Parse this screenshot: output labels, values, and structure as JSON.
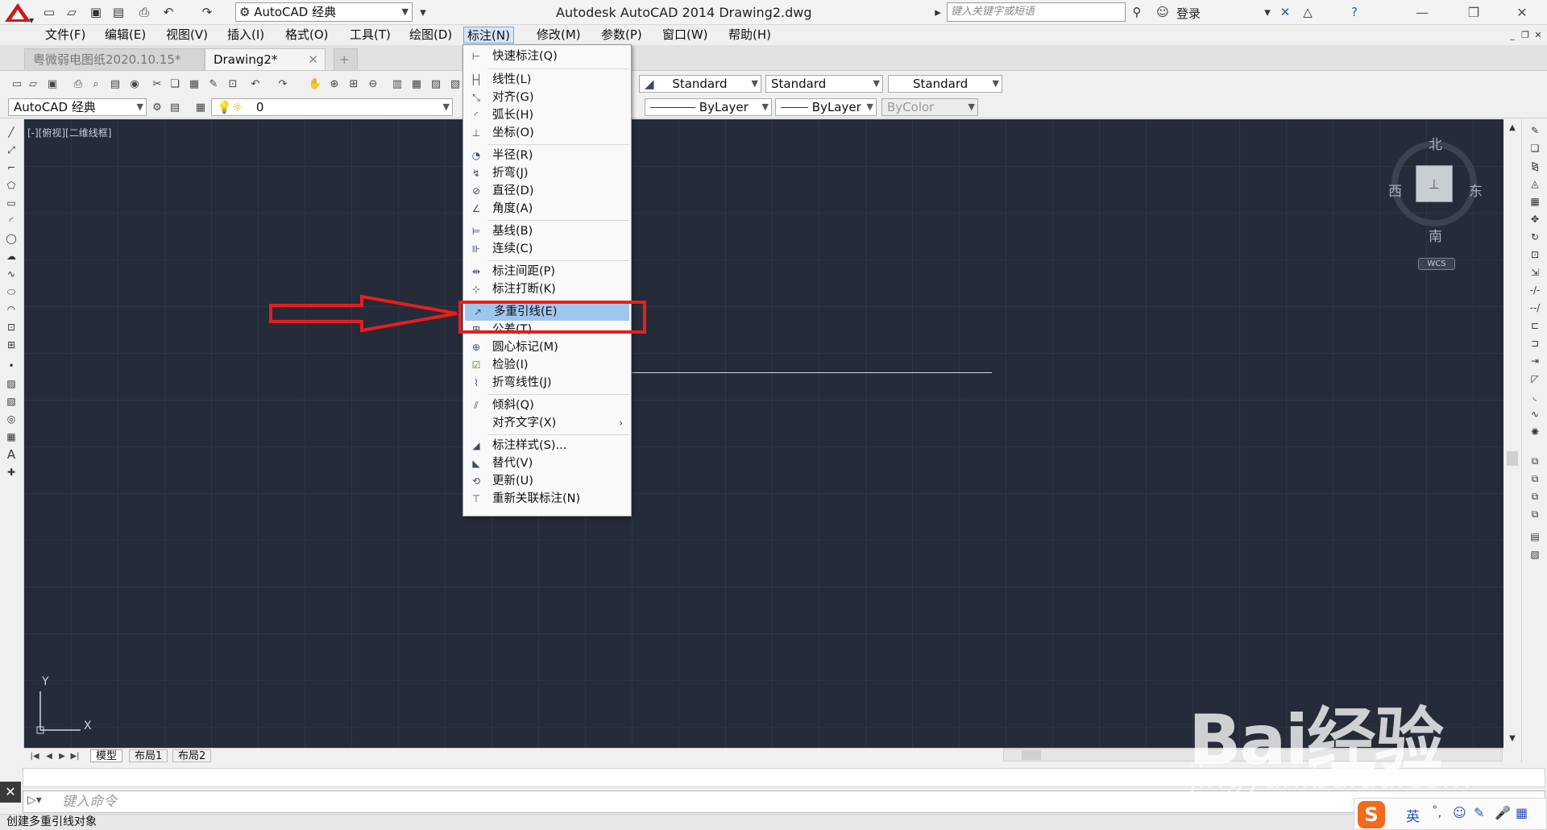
{
  "app": {
    "title": "Autodesk AutoCAD 2014    Drawing2.dwg",
    "workspace": "AutoCAD 经典",
    "search_placeholder": "键入关键字或短语",
    "login": "登录"
  },
  "menubar": {
    "items": [
      "文件(F)",
      "编辑(E)",
      "视图(V)",
      "插入(I)",
      "格式(O)",
      "工具(T)",
      "绘图(D)",
      "标注(N)",
      "修改(M)",
      "参数(P)",
      "窗口(W)",
      "帮助(H)"
    ]
  },
  "doc_tabs": [
    "粤微弱电图纸2020.10.15*",
    "Drawing2*"
  ],
  "toolbar": {
    "text_style": "Standard",
    "dim_style": "Standard",
    "table_style": "Standard",
    "workspace": "AutoCAD 经典",
    "layer": "0",
    "linetype": "ByLayer",
    "lineweight": "ByLayer",
    "plotstyle": "ByColor"
  },
  "viewport": {
    "label": "[-][俯视][二维线框]"
  },
  "viewcube": {
    "north": "北",
    "south": "南",
    "east": "东",
    "west": "西",
    "wcs": "WCS"
  },
  "ucs": {
    "x": "X",
    "y": "Y"
  },
  "dimension_menu": {
    "items": [
      {
        "label": "快速标注(Q)",
        "icon": "quick-dimension-icon"
      },
      {
        "label": "线性(L)",
        "icon": "linear-icon"
      },
      {
        "label": "对齐(G)",
        "icon": "aligned-icon"
      },
      {
        "label": "弧长(H)",
        "icon": "arc-length-icon"
      },
      {
        "label": "坐标(O)",
        "icon": "ordinate-icon"
      },
      {
        "label": "半径(R)",
        "icon": "radius-icon"
      },
      {
        "label": "折弯(J)",
        "icon": "jogged-icon"
      },
      {
        "label": "直径(D)",
        "icon": "diameter-icon"
      },
      {
        "label": "角度(A)",
        "icon": "angular-icon"
      },
      {
        "label": "基线(B)",
        "icon": "baseline-icon"
      },
      {
        "label": "连续(C)",
        "icon": "continue-icon"
      },
      {
        "label": "标注间距(P)",
        "icon": "dim-space-icon"
      },
      {
        "label": "标注打断(K)",
        "icon": "dim-break-icon"
      },
      {
        "label": "多重引线(E)",
        "icon": "multileader-icon"
      },
      {
        "label": "公差(T)...",
        "icon": "tolerance-icon"
      },
      {
        "label": "圆心标记(M)",
        "icon": "center-mark-icon"
      },
      {
        "label": "检验(I)",
        "icon": "inspection-icon"
      },
      {
        "label": "折弯线性(J)",
        "icon": "jogged-linear-icon"
      },
      {
        "label": "倾斜(Q)",
        "icon": "oblique-icon"
      },
      {
        "label": "对齐文字(X)",
        "icon": "none"
      },
      {
        "label": "标注样式(S)...",
        "icon": "dim-style-icon"
      },
      {
        "label": "替代(V)",
        "icon": "override-icon"
      },
      {
        "label": "更新(U)",
        "icon": "update-icon"
      },
      {
        "label": "重新关联标注(N)",
        "icon": "reassociate-icon"
      }
    ],
    "selected": "多重引线(E)"
  },
  "layout_tabs": [
    "模型",
    "布局1",
    "布局2"
  ],
  "command": {
    "placeholder": "键入命令"
  },
  "status": "创建多重引线对象",
  "ime": {
    "lang": "英"
  },
  "watermark": {
    "brand": "Bai经验",
    "url": "jingyan.baidu.com"
  },
  "colors": {
    "canvas": "#252b38",
    "highlight": "#e81e1e",
    "menu_selected": "#9fc7ee"
  }
}
